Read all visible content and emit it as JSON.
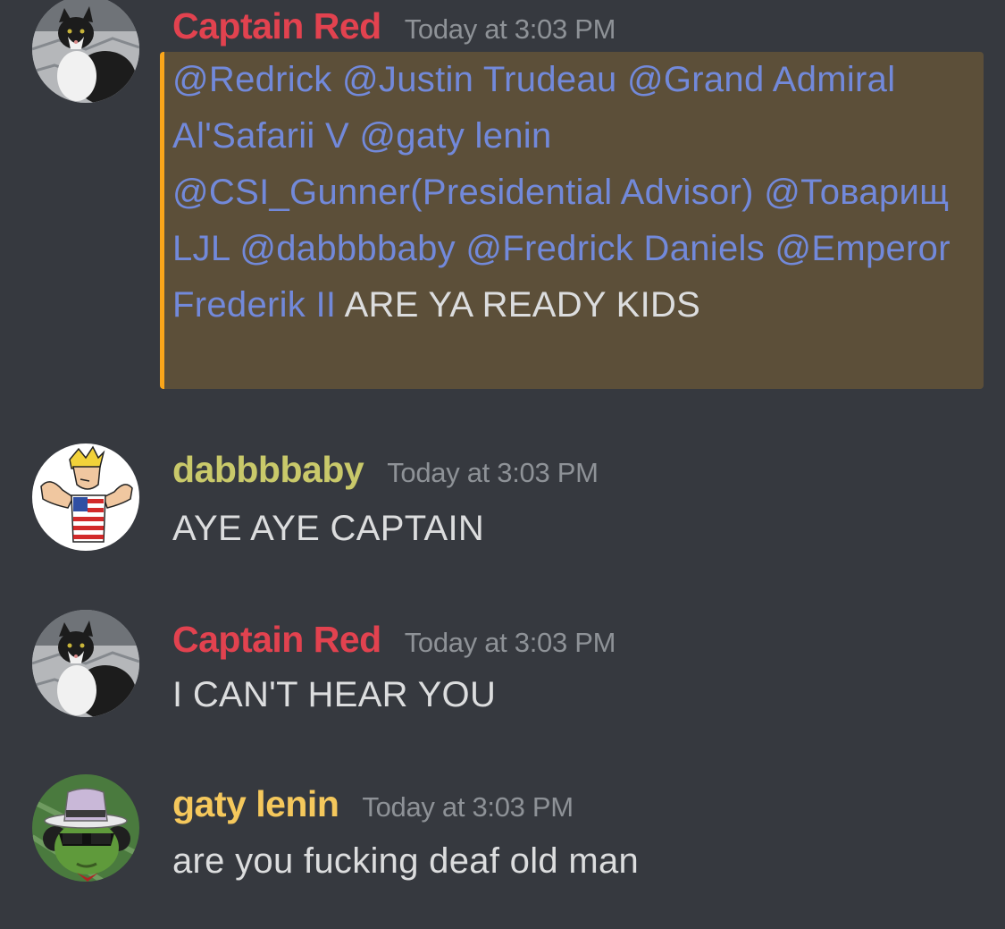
{
  "messages": [
    {
      "username": "Captain Red",
      "username_color": "#e2424f",
      "timestamp": "Today at 3:03 PM",
      "avatar_icon": "cat-avatar",
      "mentions": [
        "@Redrick",
        "@Justin Trudeau",
        "@Grand Admiral Al'Safarii V",
        "@gaty lenin",
        "@CSI_Gunner(Presidential Advisor)",
        "@Товарищ LJL",
        "@dabbbbaby",
        "@Fredrick Daniels",
        "@Emperor Frederik II"
      ],
      "text": "ARE YA READY KIDS",
      "highlighted": true
    },
    {
      "username": "dabbbbaby",
      "username_color": "#c9c96a",
      "timestamp": "Today at 3:03 PM",
      "avatar_icon": "flexing-man-avatar",
      "text": "AYE AYE CAPTAIN"
    },
    {
      "username": "Captain Red",
      "username_color": "#e2424f",
      "timestamp": "Today at 3:03 PM",
      "avatar_icon": "cat-avatar",
      "text": "I CAN'T HEAR YOU"
    },
    {
      "username": "gaty lenin",
      "username_color": "#f5c85c",
      "timestamp": "Today at 3:03 PM",
      "avatar_icon": "pepe-hat-avatar",
      "text": "are you fucking deaf old man"
    }
  ],
  "colors": {
    "background": "#36393f",
    "mention": "#7289da",
    "highlight_bg": "#5c4f39",
    "highlight_border": "#faa61a",
    "timestamp": "#8e9297",
    "text": "#dcddde"
  }
}
